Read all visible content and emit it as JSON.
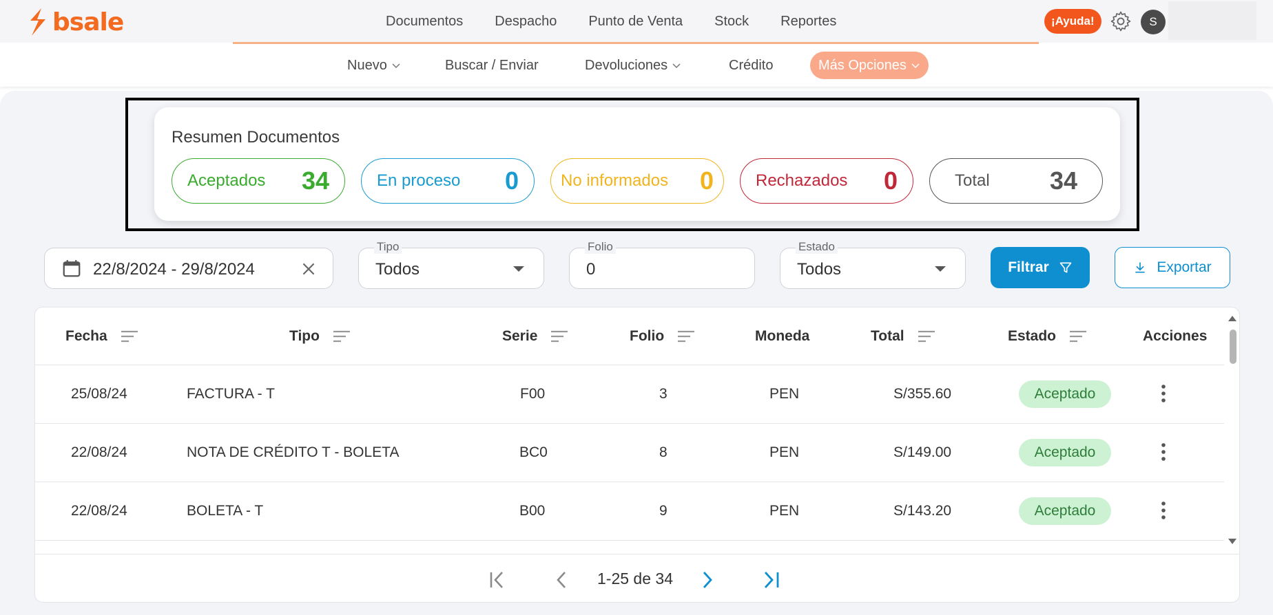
{
  "app": {
    "brand": "bsale",
    "brand_color": "#f26b21"
  },
  "main_nav": [
    "Documentos",
    "Despacho",
    "Punto de Venta",
    "Stock",
    "Reportes"
  ],
  "header_right": {
    "help_label": "¡Ayuda!",
    "avatar_initial": "S"
  },
  "sub_nav": {
    "nuevo": "Nuevo",
    "buscar": "Buscar / Enviar",
    "devoluciones": "Devoluciones",
    "credito": "Crédito",
    "mas_opciones": "Más Opciones"
  },
  "summary": {
    "title": "Resumen Documentos",
    "items": [
      {
        "label": "Aceptados",
        "value": "34",
        "color": "#3aab2f"
      },
      {
        "label": "En proceso",
        "value": "0",
        "color": "#1a9bd0"
      },
      {
        "label": "No informados",
        "value": "0",
        "color": "#f0b41e"
      },
      {
        "label": "Rechazados",
        "value": "0",
        "color": "#c0283a"
      },
      {
        "label": "Total",
        "value": "34",
        "color": "#555555"
      }
    ]
  },
  "filters": {
    "date_range": "22/8/2024 - 29/8/2024",
    "tipo_label": "Tipo",
    "tipo_value": "Todos",
    "folio_label": "Folio",
    "folio_value": "0",
    "estado_label": "Estado",
    "estado_value": "Todos",
    "filter_button": "Filtrar",
    "export_button": "Exportar"
  },
  "table": {
    "headers": {
      "fecha": "Fecha",
      "tipo": "Tipo",
      "serie": "Serie",
      "folio": "Folio",
      "moneda": "Moneda",
      "total": "Total",
      "estado": "Estado",
      "acciones": "Acciones"
    },
    "rows": [
      {
        "fecha": "25/08/24",
        "tipo": "FACTURA - T",
        "serie": "F00",
        "folio": "3",
        "moneda": "PEN",
        "total": "S/355.60",
        "estado": "Aceptado"
      },
      {
        "fecha": "22/08/24",
        "tipo": "NOTA DE CRÉDITO T - BOLETA",
        "serie": "BC0",
        "folio": "8",
        "moneda": "PEN",
        "total": "S/149.00",
        "estado": "Aceptado"
      },
      {
        "fecha": "22/08/24",
        "tipo": "BOLETA - T",
        "serie": "B00",
        "folio": "9",
        "moneda": "PEN",
        "total": "S/143.20",
        "estado": "Aceptado"
      }
    ],
    "pagination": "1-25 de 34"
  }
}
